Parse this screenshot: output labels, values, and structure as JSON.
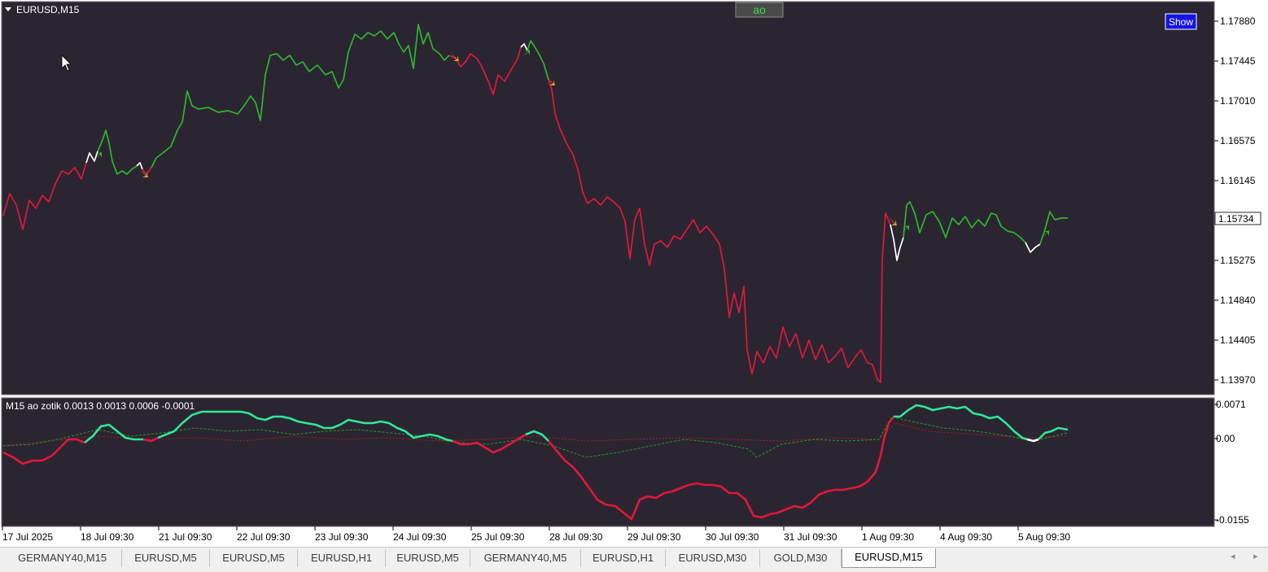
{
  "symbol_label": "EURUSD,M15",
  "indicator_button": "ao",
  "show_button": "Show",
  "current_price": "1.15734",
  "price_axis": [
    "1.17880",
    "1.17445",
    "1.17010",
    "1.16575",
    "1.16145",
    "1.15275",
    "1.14840",
    "1.14405",
    "1.13970"
  ],
  "indicator_info": "M15 ao zotik  0.0013 0.0013 0.0006 -0.0001",
  "indicator_axis": [
    "0.0071",
    "0.00",
    "-0.0155"
  ],
  "time_axis": [
    "17 Jul 2025",
    "18 Jul 09:30",
    "21 Jul 09:30",
    "22 Jul 09:30",
    "23 Jul 09:30",
    "24 Jul 09:30",
    "25 Jul 09:30",
    "28 Jul 09:30",
    "29 Jul 09:30",
    "30 Jul 09:30",
    "31 Jul 09:30",
    "1 Aug 09:30",
    "4 Aug 09:30",
    "5 Aug 09:30"
  ],
  "tabs": [
    "GERMANY40,M15",
    "EURUSD,M5",
    "EURUSD,M5",
    "EURUSD,H1",
    "EURUSD,M5",
    "GERMANY40,M5",
    "EURUSD,H1",
    "EURUSD,M30",
    "GOLD,M30",
    "EURUSD,M15"
  ],
  "active_tab": "EURUSD,M15",
  "scroll_left_icon": "◂",
  "scroll_right_icon": "▸",
  "colors": {
    "background": "#2b2531",
    "bull": "#2fb52f",
    "bear": "#dc1a3e",
    "neutral": "#ffffff",
    "arrow": "#f0a020",
    "ao_up": "#2ee89a",
    "ao_down": "#e0183c",
    "show_button": "#1414e6"
  }
}
